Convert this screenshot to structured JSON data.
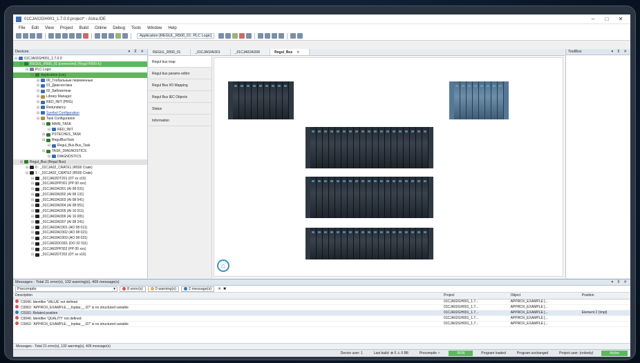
{
  "window": {
    "title": "01CJA02GH001_1.7.0.0.project* - Astra.IDE",
    "min": "–",
    "max": "□",
    "close": "✕"
  },
  "menu": [
    "File",
    "Edit",
    "View",
    "Project",
    "Build",
    "Online",
    "Debug",
    "Tools",
    "Window",
    "Help"
  ],
  "toolbar": {
    "application": "Application [REGUL_R500_01: PLC Logic]"
  },
  "devices": {
    "title": "Devices",
    "controls": "▾ ⊼ ✕",
    "tree": [
      {
        "label": "01CJA02GH001_1.7.0.0",
        "indent": 0,
        "cls": "",
        "color": "#3b6db3"
      },
      {
        "label": "REGUL_R500_01 [connected] (Regul R500-E)",
        "indent": 1,
        "cls": "sel",
        "color": "#2f7a2f"
      },
      {
        "label": "PLC Logic",
        "indent": 2,
        "cls": "",
        "color": "#8c6bb1"
      },
      {
        "label": "Application [run]",
        "indent": 3,
        "cls": "app",
        "color": "#2f7a2f"
      },
      {
        "label": "00_Глобальные переменные",
        "indent": 4,
        "cls": "",
        "color": "#3b6db3"
      },
      {
        "label": "01_Диагностика",
        "indent": 4,
        "cls": "",
        "color": "#3b6db3"
      },
      {
        "label": "02_Библиотеки",
        "indent": 4,
        "cls": "",
        "color": "#3b6db3"
      },
      {
        "label": "Library Manager",
        "indent": 4,
        "cls": "",
        "color": "#b38b3b"
      },
      {
        "label": "RED_INIT (PRG)",
        "indent": 4,
        "cls": "",
        "color": "#3b6db3"
      },
      {
        "label": "Redundancy",
        "indent": 4,
        "cls": "",
        "color": "#3b6db3"
      },
      {
        "label": "Symbol Configuration",
        "indent": 4,
        "cls": "link",
        "color": "#3b6db3"
      },
      {
        "label": "Task Configuration",
        "indent": 4,
        "cls": "",
        "color": "#b38b3b"
      },
      {
        "label": "MAIN_TASK",
        "indent": 5,
        "cls": "",
        "color": "#2f7a2f"
      },
      {
        "label": "RED_INIT",
        "indent": 6,
        "cls": "",
        "color": "#3b6db3"
      },
      {
        "label": "PSTECHES_TASK",
        "indent": 5,
        "cls": "",
        "color": "#2f7a2f"
      },
      {
        "label": "RegulBusTask",
        "indent": 5,
        "cls": "",
        "color": "#2f7a2f"
      },
      {
        "label": "Regul_Bus.Bus_Task",
        "indent": 6,
        "cls": "",
        "color": "#3b6db3"
      },
      {
        "label": "TASK_DIAGNOSTICS",
        "indent": 5,
        "cls": "",
        "color": "#2f7a2f"
      },
      {
        "label": "DIAGNOSTICS",
        "indent": 6,
        "cls": "",
        "color": "#3b6db3"
      },
      {
        "label": "Regul_Bus (Regul Bus)",
        "indent": 1,
        "cls": "gray",
        "color": "#2f7a2f"
      },
      {
        "label": "0 : _01CJA02_CRATE1 (R500 Crate)",
        "indent": 2,
        "cls": "",
        "color": "#222"
      },
      {
        "label": "1 : _01CJA02_CRATE2 (R500 Crate)",
        "indent": 2,
        "cls": "",
        "color": "#222"
      },
      {
        "label": "_01CJA02DT201 (DT xx x16)",
        "indent": 3,
        "cls": "",
        "color": "#222"
      },
      {
        "label": "_01CJA02PP301 (PP 00 xxx)",
        "indent": 3,
        "cls": "",
        "color": "#222"
      },
      {
        "label": "_01CJA02AI301 (AI 08 031)",
        "indent": 3,
        "cls": "",
        "color": "#222"
      },
      {
        "label": "_01CJA02AI302 (AI 08 131)",
        "indent": 3,
        "cls": "",
        "color": "#222"
      },
      {
        "label": "_01CJA02AI303 (AI 08 041)",
        "indent": 3,
        "cls": "",
        "color": "#222"
      },
      {
        "label": "_01CJA02AI304 (AI 08 051)",
        "indent": 3,
        "cls": "",
        "color": "#222"
      },
      {
        "label": "_01CJA02AI305 (AI 16 011)",
        "indent": 3,
        "cls": "",
        "color": "#222"
      },
      {
        "label": "_01CJA02AI306 (AI 16 081)",
        "indent": 3,
        "cls": "",
        "color": "#222"
      },
      {
        "label": "_01CJA02AI307 (AI 08 241)",
        "indent": 3,
        "cls": "",
        "color": "#222"
      },
      {
        "label": "_01CJA02AO301 (AO 08 011)",
        "indent": 3,
        "cls": "",
        "color": "#222"
      },
      {
        "label": "_01CJA02AO302 (AO 08 021)",
        "indent": 3,
        "cls": "",
        "color": "#222"
      },
      {
        "label": "_01CJA02AO303 (AO 08 031)",
        "indent": 3,
        "cls": "",
        "color": "#222"
      },
      {
        "label": "_01CJA02DO301 (DO 32 011)",
        "indent": 3,
        "cls": "",
        "color": "#222"
      },
      {
        "label": "_01CJA02PP302 (PP 00 xxx)",
        "indent": 3,
        "cls": "",
        "color": "#222"
      },
      {
        "label": "_01CJA02DT202 (DT xx x16)",
        "indent": 3,
        "cls": "",
        "color": "#222"
      }
    ]
  },
  "editor": {
    "tabs": [
      {
        "label": "REGUL_R500_01",
        "active": false
      },
      {
        "label": "_01CJA02AI301",
        "active": false
      },
      {
        "label": "_01CJA02AI306",
        "active": false
      },
      {
        "label": "Regul_Bus",
        "active": true
      }
    ],
    "close": "✕",
    "nav": [
      {
        "label": "Regul bus map",
        "active": true
      },
      {
        "label": "Regul bus params editor",
        "active": false
      },
      {
        "label": "Regul Bus I/O Mapping",
        "active": false
      },
      {
        "label": "Regul Bus IEC Objects",
        "active": false
      },
      {
        "label": "Status",
        "active": false
      },
      {
        "label": "Information",
        "active": false
      }
    ],
    "home_icon": "⌂"
  },
  "toolbox": {
    "title": "ToolBox",
    "controls": "▾ ⊼ ✕"
  },
  "messages": {
    "title": "Messages - Total 21 error(s), 132 warning(s), 409 message(s)",
    "controls": "▾ ⊼ ✕",
    "filter": "Precompile",
    "errors": "8 error(s)",
    "warnings": "0 warning(s)",
    "infos": "2 message(s)",
    "columns": [
      "Description",
      "Project",
      "Object",
      "Position"
    ],
    "rows": [
      {
        "desc": "C0046: Identifier 'VALUE' not defined",
        "project": "01CJA02GH001_1.7...",
        "object": "APPROX_EXAMPLE [...",
        "position": "",
        "level": "err"
      },
      {
        "desc": "C0062: 'APPROX_EXAMPLE.__Inpitar__.I27' is no structured variable",
        "project": "01CJA02GH001_1.7...",
        "object": "APPROX_EXAMPLE [...",
        "position": "",
        "level": "err"
      },
      {
        "desc": "C0181: Related position",
        "project": "01CJA02GH001_1.7...",
        "object": "APPROX_EXAMPLE [...",
        "position": "Element 2 (Impl)",
        "level": "info"
      },
      {
        "desc": "C0046: Identifier 'QUALITY' not defined",
        "project": "01CJA02GH001_1.7...",
        "object": "APPROX_EXAMPLE [...",
        "position": "",
        "level": "err"
      },
      {
        "desc": "C0062: 'APPROX_EXAMPLE.__Inpitar__.I27' is no structured variable",
        "project": "01CJA02GH001_1.7...",
        "object": "APPROX_EXAMPLE [...",
        "position": "",
        "level": "err"
      }
    ],
    "footer": "Messages - Total 21 error(s), 132 warning(s), 409 message(s)"
  },
  "status": {
    "device_user": "Device user: 1",
    "last_build": "Last build: ⊗ 0 ⚠ 0 B8",
    "precompile": "Precompile ✓",
    "run": "RUN",
    "program": "Program loaded",
    "unchanged": "Program unchanged",
    "project_user": "Project user: (nobody)",
    "active": "Active"
  }
}
